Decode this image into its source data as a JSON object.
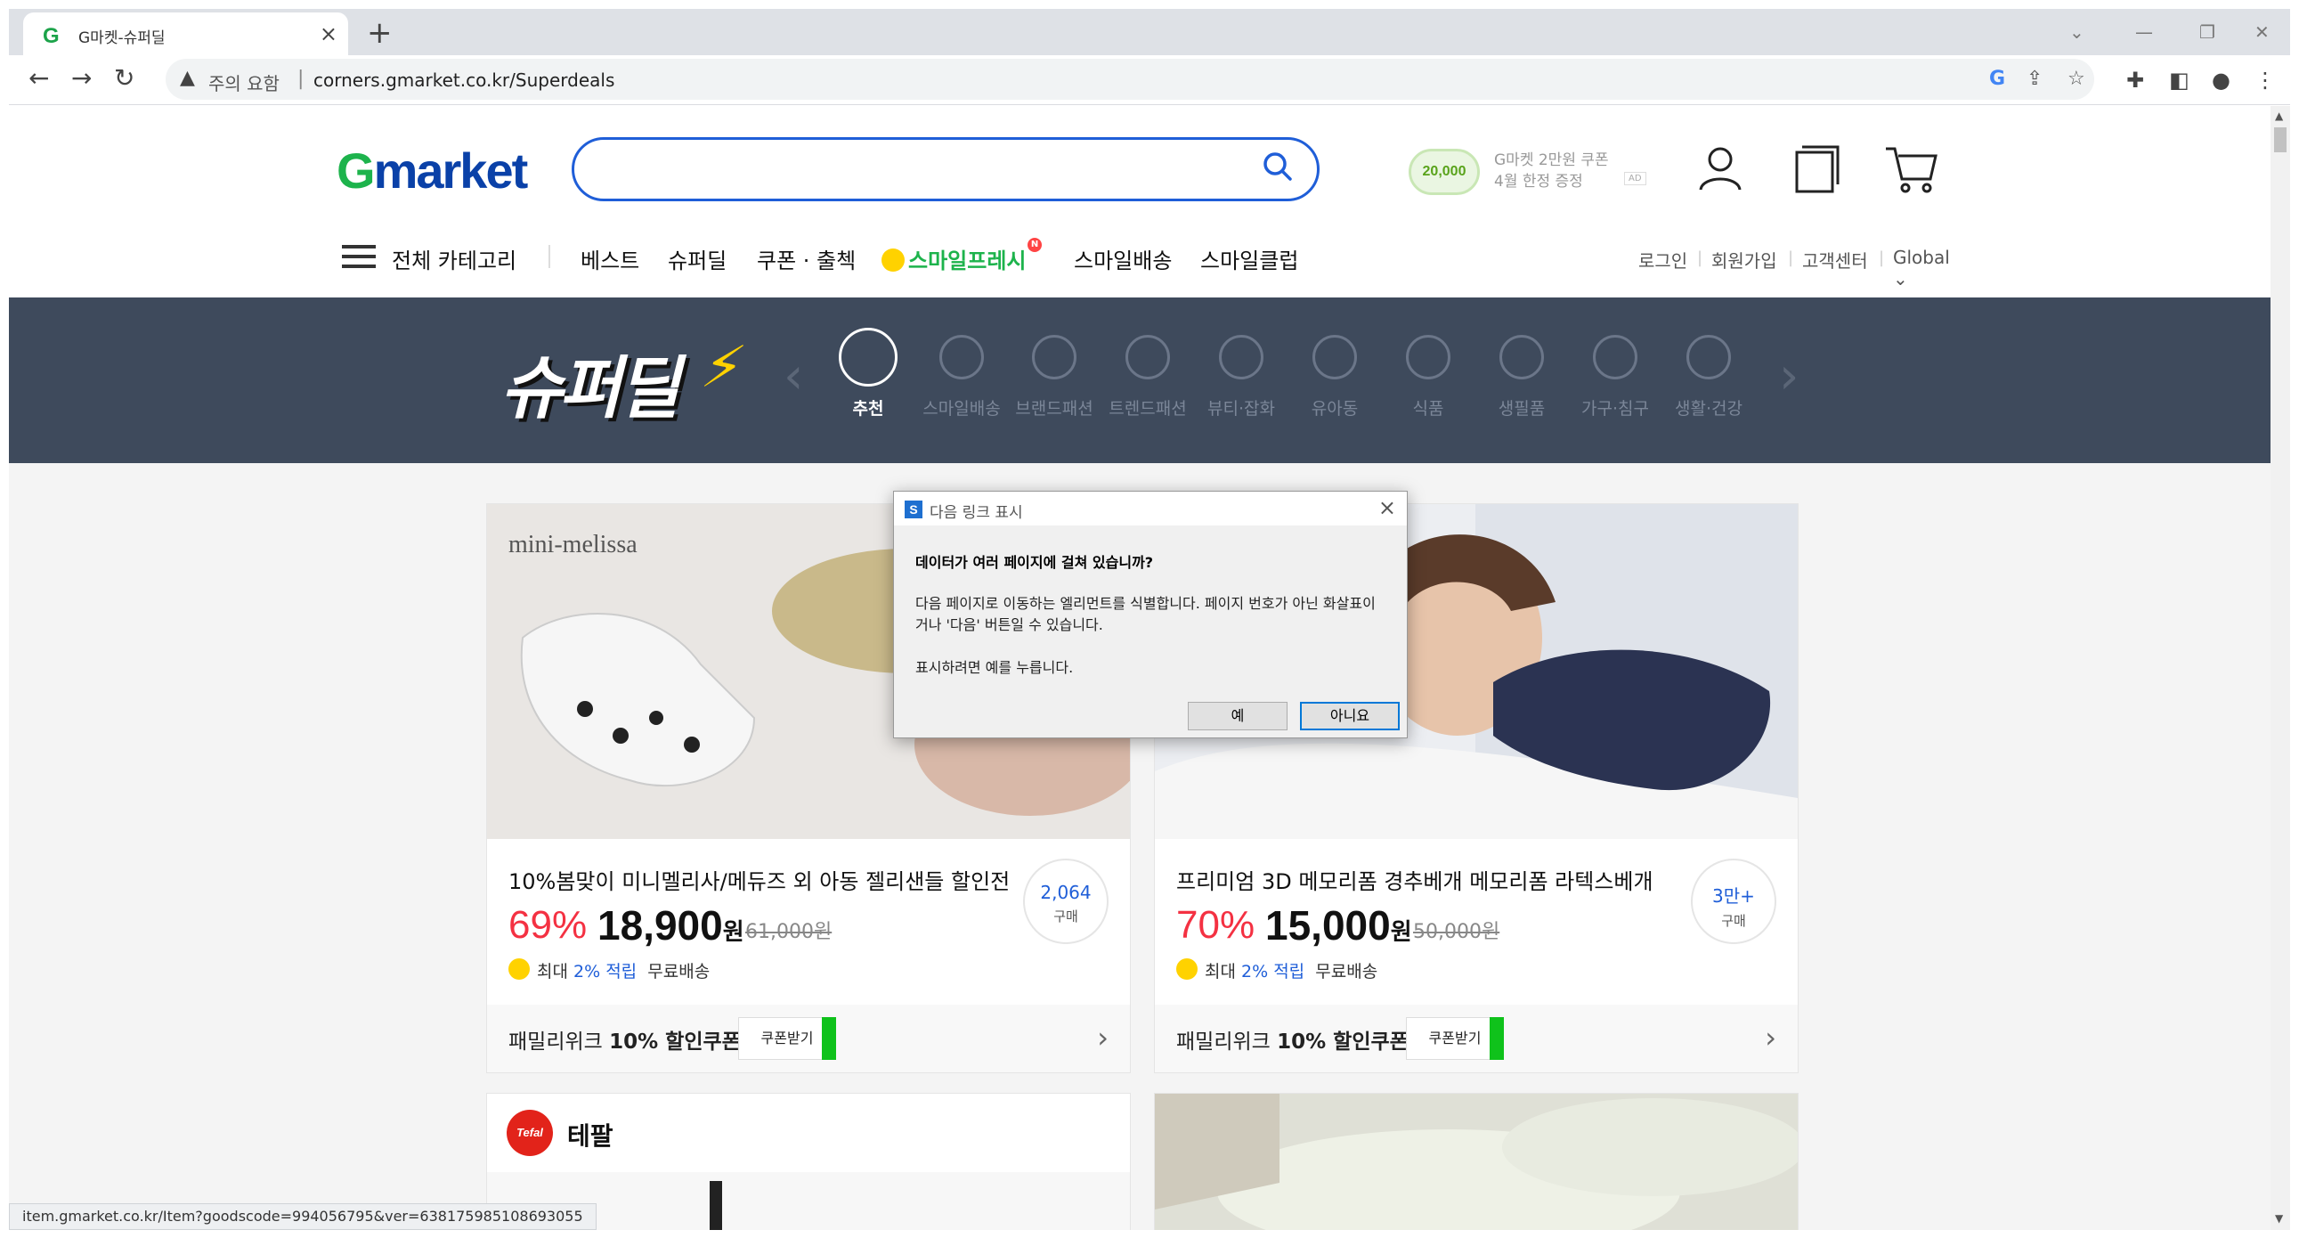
{
  "browser": {
    "tab_title": "G마켓-슈퍼딜",
    "tab_favicon_letter": "G",
    "security_label": "주의 요함",
    "url": "corners.gmarket.co.kr/Superdeals",
    "status_url": "item.gmarket.co.kr/Item?goodscode=994056795&ver=638175985108693055"
  },
  "header": {
    "logo_g": "G",
    "logo_rest": "market",
    "ad": {
      "coin_value": "20,000",
      "line1": "G마켓 2만원 쿠폰",
      "line2": "4월 한정 증정",
      "ad_badge": "AD"
    },
    "icons": [
      "user-icon",
      "recent-items-icon",
      "cart-icon"
    ]
  },
  "gnb": {
    "all_categories": "전체 카테고리",
    "menu": [
      "베스트",
      "슈퍼딜",
      "쿠폰 · 출첵",
      "스마일프레시",
      "스마일배송",
      "스마일클럽"
    ],
    "new_badge": "N",
    "util": [
      "로그인",
      "회원가입",
      "고객센터",
      "Global ⌄"
    ]
  },
  "banner": {
    "logo_text": "슈퍼딜",
    "categories": [
      "추천",
      "스마일배송",
      "브랜드패션",
      "트렌드패션",
      "뷰티·잡화",
      "유아동",
      "식품",
      "생필품",
      "가구·침구",
      "생활·건강"
    ],
    "active_index": 0
  },
  "deals": [
    {
      "image_brand": "mini-melissa",
      "name": "10%봄맞이 미니멜리사/메듀즈 외 아동 젤리샌들 할인전",
      "discount": "69%",
      "price": "18,900",
      "won": "원",
      "original": "61,000원",
      "points_prefix": "최대",
      "points_rate": "2% 적립",
      "shipping": "무료배송",
      "buy_count": "2,064",
      "buy_unit": "구매",
      "coupon_text": "패밀리위크",
      "coupon_bold": "10% 할인쿠폰",
      "coupon_button": "쿠폰받기"
    },
    {
      "image_brand": "",
      "name": "프리미엄 3D 메모리폼 경추베개 메모리폼 라텍스베개",
      "discount": "70%",
      "price": "15,000",
      "won": "원",
      "original": "50,000원",
      "points_prefix": "최대",
      "points_rate": "2% 적립",
      "shipping": "무료배송",
      "buy_count": "3만+",
      "buy_unit": "구매",
      "coupon_text": "패밀리위크",
      "coupon_bold": "10% 할인쿠폰",
      "coupon_button": "쿠폰받기"
    }
  ],
  "brand_card": {
    "logo_text": "Tefal",
    "name": "테팔"
  },
  "dialog": {
    "title": "다음 링크 표시",
    "icon_letter": "S",
    "heading": "데이터가 여러 페이지에 걸쳐 있습니까?",
    "body": "다음 페이지로 이동하는 엘리먼트를 식별합니다. 페이지 번호가 아닌 화살표이거나 '다음' 버튼일 수 있습니다.",
    "hint": "표시하려면 예를 누릅니다.",
    "yes": "예",
    "no": "아니요"
  },
  "colors": {
    "gmarket_green": "#1db34c",
    "gmarket_blue": "#0a41a8",
    "search_border": "#1f5ed8",
    "banner_bg": "#3e4a5c",
    "discount_red": "#f43142",
    "coupon_green": "#0fc21b"
  }
}
